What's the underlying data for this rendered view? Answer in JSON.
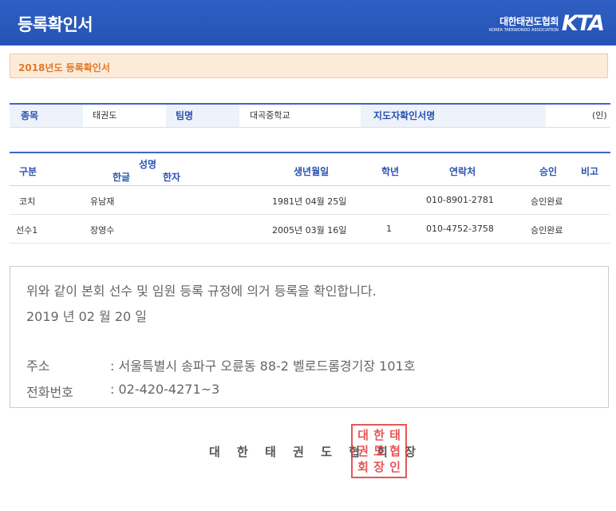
{
  "header": {
    "title": "등록확인서",
    "logo_ko": "대한태권도협회",
    "logo_en": "KOREA TAEKWONDO ASSOCIATION",
    "logo_mark": "KTA"
  },
  "season_label": "2018년도 등록확인서",
  "info": {
    "sport_label": "종목",
    "sport_value": "태권도",
    "team_label": "팀명",
    "team_value": "대곡중학교",
    "coach_sign_label": "지도자확인서명",
    "seal_mark": "(인)"
  },
  "table": {
    "headers": {
      "category": "구분",
      "name_group": "성명",
      "name_korean": "한글",
      "name_hanja": "한자",
      "birthdate": "생년월일",
      "grade": "학년",
      "contact": "연락처",
      "approval": "승인",
      "remarks": "비고"
    },
    "rows": [
      {
        "category": "코치",
        "name_korean": "유남재",
        "name_hanja": "",
        "birthdate": "1981년 04월 25일",
        "grade": "",
        "contact": "010-8901-2781",
        "approval": "승인완료",
        "remarks": ""
      },
      {
        "category": "선수1",
        "name_korean": "장영수",
        "name_hanja": "",
        "birthdate": "2005년 03월 16일",
        "grade": "1",
        "contact": "010-4752-3758",
        "approval": "승인완료",
        "remarks": ""
      }
    ]
  },
  "notice": {
    "statement": "위와 같이 본회 선수 및 임원 등록 규정에 의거 등록을 확인합니다.",
    "date": "2019 년  02 월  20 일",
    "address_label": "주소",
    "address_value": ": 서울특별시 송파구 오륜동 88-2 벨로드롬경기장 101호",
    "phone_label": "전화번호",
    "phone_value": ": 02-420-4271~3"
  },
  "association_name": "대 한 태 권 도 협 회 장",
  "seal_text": "대한태권도협회장인",
  "colors": {
    "header_bg": "#2553b5",
    "accent_blue": "#2a52b2",
    "season_orange": "#e07a2a",
    "seal_red": "#e23a3a"
  }
}
